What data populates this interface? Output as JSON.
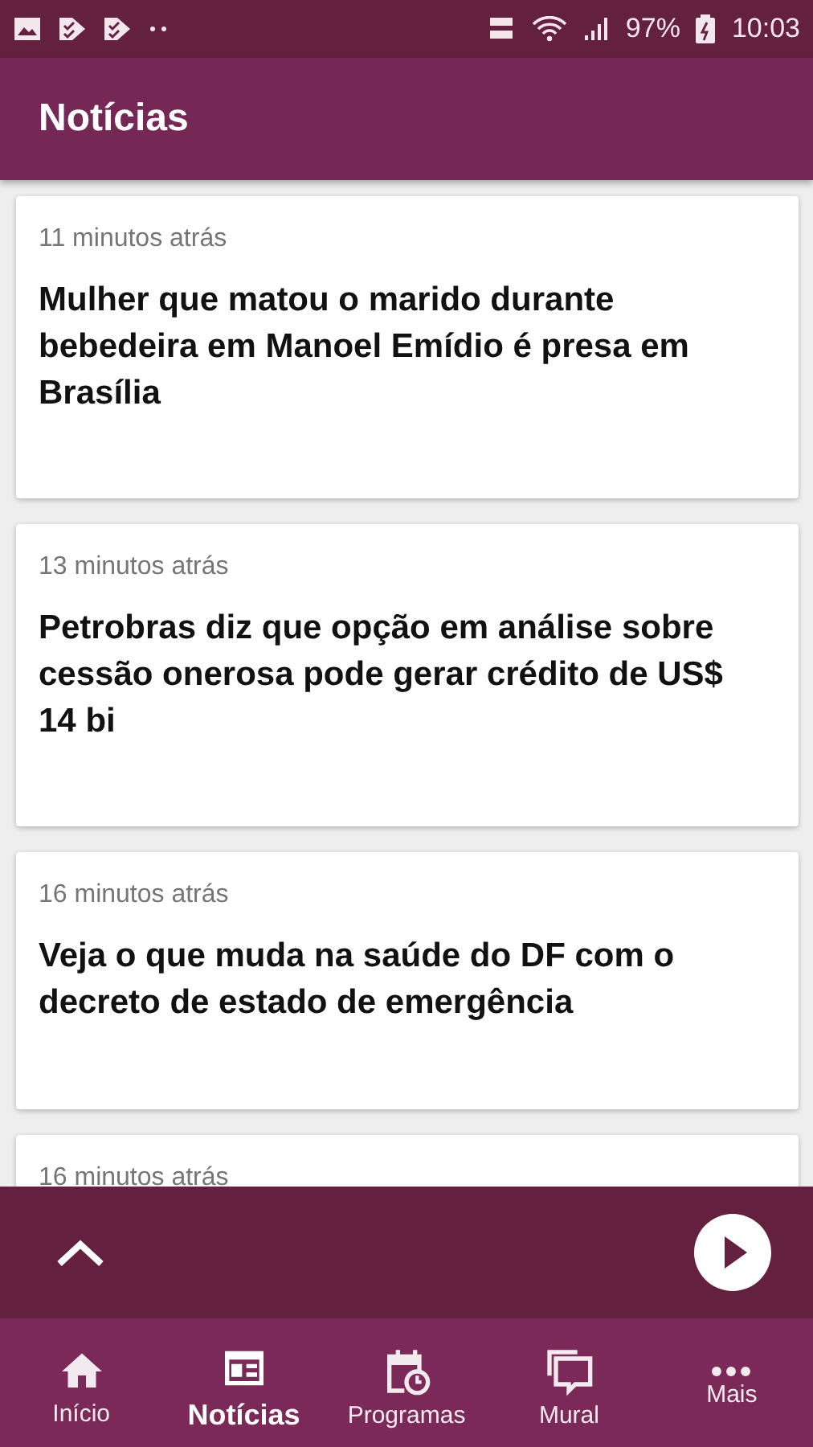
{
  "status_bar": {
    "battery": "97%",
    "time": "10:03"
  },
  "app_bar": {
    "title": "Notícias"
  },
  "news": [
    {
      "time": "11 minutos atrás",
      "headline": "Mulher que matou o marido durante bebedeira em Manoel Emídio é presa em Brasília"
    },
    {
      "time": "13 minutos atrás",
      "headline": "Petrobras diz que opção em análise sobre cessão onerosa pode gerar crédito de US$ 14 bi"
    },
    {
      "time": "16 minutos atrás",
      "headline": "Veja o que muda na saúde do DF com o decreto de estado de emergência"
    },
    {
      "time": "16 minutos atrás"
    }
  ],
  "bottom_nav": [
    {
      "label": "Início",
      "kind": "home",
      "selected": false
    },
    {
      "label": "Notícias",
      "kind": "news",
      "selected": true
    },
    {
      "label": "Programas",
      "kind": "schedule",
      "selected": false
    },
    {
      "label": "Mural",
      "kind": "chat",
      "selected": false
    },
    {
      "label": "Mais",
      "kind": "more",
      "selected": false
    }
  ]
}
